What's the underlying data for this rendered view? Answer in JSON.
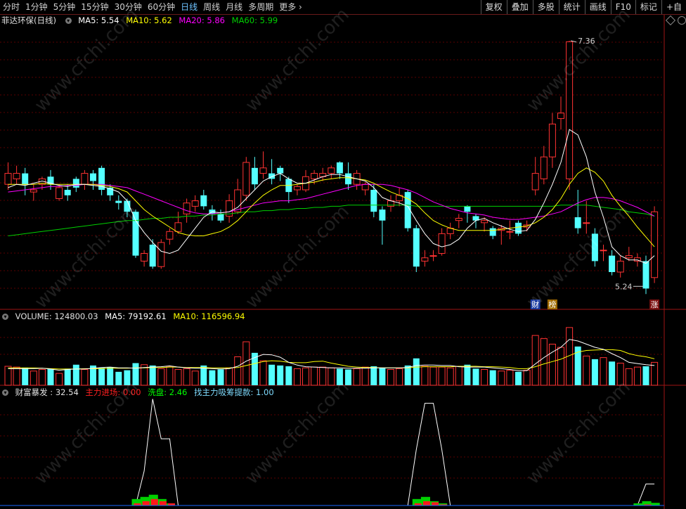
{
  "toolbar": {
    "periods": [
      "分时",
      "1分钟",
      "5分钟",
      "15分钟",
      "30分钟",
      "60分钟",
      "日线",
      "周线",
      "月线",
      "多周期",
      "更多"
    ],
    "active_period": "日线",
    "right_buttons": [
      "复权",
      "叠加",
      "多股",
      "统计",
      "画线",
      "F10",
      "标记",
      "+自"
    ]
  },
  "price_legend": {
    "name": "菲达环保(日线)",
    "ma5": "MA5: 5.54",
    "ma10": "MA10: 5.62",
    "ma20": "MA20: 5.86",
    "ma60": "MA60: 5.99"
  },
  "volume_legend": {
    "volume": "VOLUME: 124800.03",
    "ma5": "MA5: 79192.61",
    "ma10": "MA10: 116596.94"
  },
  "indicator_legend": {
    "name": "财富暴发 : 32.54",
    "main_entry": "主力进场: 0.00",
    "washout": "洗盘: 2.46",
    "accumulation": "找主力吸筹提款: 1.00"
  },
  "colors": {
    "up": "#ff3232",
    "down": "#54ffff",
    "ma5": "#ffffff",
    "ma10": "#ffff00",
    "ma20": "#ff00ff",
    "ma60": "#00d000",
    "grid": "#5a0000",
    "separator": "#a01414"
  },
  "chart_data": [
    {
      "type": "candlestick",
      "series_name": "菲达环保(日线)",
      "ylim": [
        5.0,
        7.5
      ],
      "high_label": "7.36",
      "low_label": "5.24",
      "markers": [
        "财",
        "榜",
        "涨"
      ],
      "candles": [
        [
          6.05,
          6.15,
          6.25,
          6.0
        ],
        [
          6.1,
          6.15,
          6.22,
          6.05
        ],
        [
          6.15,
          6.05,
          6.2,
          5.95
        ],
        [
          5.98,
          6.0,
          6.05,
          5.9
        ],
        [
          6.05,
          6.1,
          6.12,
          6.0
        ],
        [
          6.12,
          6.05,
          6.18,
          6.0
        ],
        [
          5.92,
          6.02,
          6.05,
          5.9
        ],
        [
          6.0,
          5.95,
          6.05,
          5.9
        ],
        [
          6.1,
          6.02,
          6.12,
          5.98
        ],
        [
          6.05,
          6.15,
          6.18,
          6.0
        ],
        [
          6.15,
          6.08,
          6.18,
          6.0
        ],
        [
          6.2,
          6.0,
          6.22,
          5.95
        ],
        [
          6.02,
          5.95,
          6.05,
          5.9
        ],
        [
          5.9,
          5.88,
          5.95,
          5.82
        ],
        [
          5.9,
          5.8,
          5.92,
          5.75
        ],
        [
          5.8,
          5.4,
          5.82,
          5.38
        ],
        [
          5.35,
          5.42,
          5.45,
          5.3
        ],
        [
          5.5,
          5.3,
          5.55,
          5.28
        ],
        [
          5.3,
          5.52,
          5.55,
          5.28
        ],
        [
          5.55,
          5.62,
          5.65,
          5.5
        ],
        [
          5.62,
          5.7,
          5.8,
          5.6
        ],
        [
          5.78,
          5.88,
          5.92,
          5.7
        ],
        [
          5.85,
          5.9,
          5.95,
          5.8
        ],
        [
          5.95,
          5.85,
          6.0,
          5.82
        ],
        [
          5.82,
          5.78,
          5.86,
          5.72
        ],
        [
          5.78,
          5.72,
          5.82,
          5.7
        ],
        [
          5.76,
          5.9,
          5.96,
          5.7
        ],
        [
          5.8,
          6.0,
          6.1,
          5.78
        ],
        [
          5.95,
          6.25,
          6.3,
          5.9
        ],
        [
          6.2,
          6.05,
          6.3,
          6.0
        ],
        [
          6.15,
          6.2,
          6.35,
          6.1
        ],
        [
          6.15,
          6.1,
          6.28,
          6.05
        ],
        [
          6.2,
          6.15,
          6.22,
          6.08
        ],
        [
          6.1,
          5.98,
          6.12,
          5.88
        ],
        [
          6.0,
          6.03,
          6.05,
          5.95
        ],
        [
          6.0,
          6.12,
          6.18,
          5.98
        ],
        [
          6.1,
          6.15,
          6.18,
          6.05
        ],
        [
          6.12,
          6.15,
          6.2,
          6.08
        ],
        [
          6.15,
          6.2,
          6.22,
          6.1
        ],
        [
          6.25,
          6.15,
          6.26,
          6.1
        ],
        [
          6.15,
          6.05,
          6.25,
          6.0
        ],
        [
          6.05,
          6.15,
          6.18,
          6.0
        ],
        [
          6.0,
          6.05,
          6.07,
          5.95
        ],
        [
          6.0,
          5.8,
          6.05,
          5.75
        ],
        [
          5.82,
          5.72,
          5.85,
          5.5
        ],
        [
          5.85,
          5.9,
          5.95,
          5.8
        ],
        [
          5.9,
          5.95,
          6.02,
          5.85
        ],
        [
          5.98,
          5.65,
          6.0,
          5.62
        ],
        [
          5.65,
          5.3,
          5.68,
          5.25
        ],
        [
          5.35,
          5.38,
          5.45,
          5.3
        ],
        [
          5.4,
          5.4,
          5.45,
          5.35
        ],
        [
          5.42,
          5.6,
          5.65,
          5.4
        ],
        [
          5.6,
          5.65,
          5.7,
          5.55
        ],
        [
          5.72,
          5.74,
          5.78,
          5.65
        ],
        [
          5.85,
          5.8,
          5.86,
          5.7
        ],
        [
          5.76,
          5.72,
          5.78,
          5.65
        ],
        [
          5.7,
          5.72,
          5.75,
          5.62
        ],
        [
          5.65,
          5.58,
          5.67,
          5.55
        ],
        [
          5.63,
          5.65,
          5.68,
          5.5
        ],
        [
          5.62,
          5.62,
          5.72,
          5.55
        ],
        [
          5.7,
          5.6,
          5.72,
          5.58
        ],
        [
          5.66,
          5.68,
          5.72,
          5.62
        ],
        [
          6.0,
          6.15,
          6.3,
          5.95
        ],
        [
          6.1,
          6.3,
          6.4,
          6.05
        ],
        [
          6.3,
          6.6,
          6.7,
          6.2
        ],
        [
          6.65,
          6.7,
          6.85,
          6.55
        ],
        [
          6.1,
          7.35,
          7.36,
          6.0
        ],
        [
          5.75,
          5.65,
          6.0,
          5.6
        ],
        [
          5.7,
          5.7,
          5.9,
          5.6
        ],
        [
          5.6,
          5.35,
          5.65,
          5.3
        ],
        [
          5.45,
          5.45,
          5.5,
          5.35
        ],
        [
          5.4,
          5.25,
          5.45,
          5.22
        ],
        [
          5.25,
          5.35,
          5.4,
          5.2
        ],
        [
          5.38,
          5.4,
          5.48,
          5.35
        ],
        [
          5.35,
          5.38,
          5.42,
          5.3
        ],
        [
          5.35,
          5.1,
          5.4,
          5.05
        ],
        [
          5.2,
          5.8,
          5.85,
          5.15
        ]
      ],
      "ma5": [
        6.02,
        6.05,
        6.04,
        6.06,
        6.08,
        6.06,
        6.04,
        6.03,
        6.05,
        6.05,
        6.04,
        6.03,
        6.01,
        5.98,
        5.9,
        5.72,
        5.61,
        5.52,
        5.44,
        5.42,
        5.45,
        5.55,
        5.65,
        5.75,
        5.8,
        5.79,
        5.8,
        5.84,
        5.92,
        6.0,
        6.08,
        6.12,
        6.15,
        6.1,
        6.06,
        6.06,
        6.09,
        6.12,
        6.14,
        6.14,
        6.12,
        6.1,
        6.08,
        6.02,
        5.93,
        5.9,
        5.88,
        5.85,
        5.72,
        5.6,
        5.51,
        5.48,
        5.5,
        5.55,
        5.65,
        5.72,
        5.74,
        5.7,
        5.67,
        5.64,
        5.62,
        5.63,
        5.73,
        5.88,
        6.05,
        6.25,
        6.55,
        6.5,
        6.3,
        5.98,
        5.75,
        5.48,
        5.4,
        5.36,
        5.36,
        5.33,
        5.4
      ],
      "ma10": [
        6.05,
        6.05,
        6.05,
        6.05,
        6.06,
        6.05,
        6.05,
        6.05,
        6.05,
        6.05,
        6.05,
        6.04,
        6.03,
        6.01,
        5.98,
        5.9,
        5.82,
        5.76,
        5.71,
        5.66,
        5.61,
        5.59,
        5.58,
        5.58,
        5.6,
        5.62,
        5.66,
        5.72,
        5.8,
        5.88,
        5.95,
        6.0,
        6.04,
        6.04,
        6.05,
        6.06,
        6.07,
        6.09,
        6.1,
        6.11,
        6.11,
        6.1,
        6.09,
        6.06,
        6.02,
        5.98,
        5.95,
        5.92,
        5.87,
        5.79,
        5.72,
        5.68,
        5.65,
        5.63,
        5.63,
        5.63,
        5.63,
        5.63,
        5.64,
        5.65,
        5.66,
        5.67,
        5.7,
        5.75,
        5.82,
        5.92,
        6.05,
        6.15,
        6.2,
        6.16,
        6.08,
        5.95,
        5.85,
        5.76,
        5.66,
        5.57,
        5.48
      ],
      "ma20": [
        5.98,
        5.99,
        6.0,
        6.01,
        6.02,
        6.03,
        6.03,
        6.04,
        6.04,
        6.05,
        6.05,
        6.05,
        6.04,
        6.03,
        6.02,
        5.99,
        5.96,
        5.93,
        5.9,
        5.87,
        5.84,
        5.81,
        5.79,
        5.78,
        5.78,
        5.79,
        5.8,
        5.82,
        5.84,
        5.86,
        5.88,
        5.89,
        5.9,
        5.9,
        5.91,
        5.92,
        5.94,
        5.96,
        5.98,
        6.0,
        6.02,
        6.04,
        6.05,
        6.05,
        6.05,
        6.04,
        6.02,
        6.0,
        5.97,
        5.93,
        5.89,
        5.86,
        5.83,
        5.81,
        5.79,
        5.78,
        5.77,
        5.75,
        5.74,
        5.73,
        5.73,
        5.74,
        5.75,
        5.76,
        5.78,
        5.8,
        5.84,
        5.88,
        5.91,
        5.93,
        5.93,
        5.92,
        5.9,
        5.87,
        5.84,
        5.8,
        5.76
      ],
      "ma60": [
        5.58,
        5.59,
        5.6,
        5.61,
        5.62,
        5.63,
        5.64,
        5.65,
        5.66,
        5.67,
        5.68,
        5.69,
        5.7,
        5.71,
        5.72,
        5.72,
        5.73,
        5.74,
        5.74,
        5.75,
        5.75,
        5.76,
        5.76,
        5.77,
        5.77,
        5.78,
        5.78,
        5.79,
        5.8,
        5.8,
        5.81,
        5.81,
        5.82,
        5.82,
        5.83,
        5.83,
        5.84,
        5.84,
        5.85,
        5.85,
        5.86,
        5.86,
        5.86,
        5.86,
        5.86,
        5.86,
        5.86,
        5.86,
        5.85,
        5.85,
        5.85,
        5.85,
        5.85,
        5.85,
        5.85,
        5.85,
        5.85,
        5.85,
        5.85,
        5.85,
        5.85,
        5.85,
        5.85,
        5.85,
        5.85,
        5.86,
        5.86,
        5.86,
        5.86,
        5.85,
        5.84,
        5.83,
        5.82,
        5.8,
        5.79,
        5.78,
        5.76
      ]
    },
    {
      "type": "bar",
      "series_name": "VOLUME",
      "ylim": [
        0,
        160000
      ],
      "volume": [
        48000,
        46000,
        44000,
        36000,
        40000,
        42000,
        30000,
        42000,
        52000,
        40000,
        50000,
        44000,
        46000,
        34000,
        38000,
        56000,
        52000,
        50000,
        42000,
        48000,
        40000,
        42000,
        36000,
        50000,
        38000,
        40000,
        44000,
        72000,
        110000,
        82000,
        62000,
        52000,
        50000,
        48000,
        42000,
        44000,
        46000,
        46000,
        44000,
        42000,
        40000,
        42000,
        46000,
        48000,
        44000,
        40000,
        42000,
        50000,
        68000,
        48000,
        46000,
        46000,
        44000,
        48000,
        52000,
        42000,
        40000,
        38000,
        36000,
        38000,
        34000,
        38000,
        126000,
        118000,
        104000,
        96000,
        146000,
        98000,
        74000,
        66000,
        70000,
        60000,
        56000,
        42000,
        46000,
        48000,
        58000
      ],
      "ma5": [
        42000,
        42000,
        42000,
        42000,
        43000,
        41000,
        38000,
        40000,
        41000,
        41000,
        43000,
        45000,
        46000,
        44000,
        44000,
        43000,
        45000,
        46000,
        47000,
        49000,
        46000,
        44000,
        43000,
        43000,
        42000,
        41000,
        42000,
        48000,
        61000,
        70000,
        78000,
        77000,
        71000,
        58000,
        51000,
        47000,
        46000,
        45000,
        44000,
        44000,
        43000,
        43000,
        43000,
        44000,
        44000,
        44000,
        44000,
        45000,
        50000,
        51000,
        51000,
        50000,
        50000,
        47000,
        46000,
        46000,
        46000,
        44000,
        42000,
        40000,
        37000,
        37000,
        54000,
        70000,
        84000,
        96000,
        116000,
        112000,
        104000,
        96000,
        91000,
        80000,
        70000,
        58000,
        55000,
        52000,
        50000
      ],
      "ma10": [
        44000,
        44000,
        44000,
        44000,
        43000,
        42000,
        41000,
        41000,
        41000,
        42000,
        42000,
        42000,
        43000,
        43000,
        43000,
        44000,
        44000,
        45000,
        45000,
        46000,
        46000,
        45000,
        45000,
        45000,
        44000,
        44000,
        44000,
        45000,
        50000,
        55000,
        60000,
        62000,
        61000,
        58000,
        57000,
        57000,
        60000,
        61000,
        56000,
        52000,
        48000,
        46000,
        45000,
        45000,
        44000,
        44000,
        44000,
        44000,
        46000,
        47000,
        47000,
        47000,
        47000,
        48000,
        48000,
        48000,
        47000,
        47000,
        46000,
        45000,
        42000,
        42000,
        47000,
        54000,
        60000,
        66000,
        75000,
        84000,
        88000,
        89000,
        90000,
        90000,
        88000,
        80000,
        75000,
        72000,
        67000
      ],
      "ma_labels": [
        "MA5",
        "MA10"
      ]
    },
    {
      "type": "area",
      "series_name": "财富暴发",
      "ylim": [
        0,
        100
      ],
      "main_curve": [
        0,
        0,
        0,
        0,
        0,
        0,
        0,
        0,
        0,
        0,
        0,
        0,
        0,
        0,
        0,
        0,
        0,
        0,
        0,
        0,
        0,
        0,
        0,
        0,
        0,
        0,
        0,
        0,
        0,
        0,
        0,
        0,
        0,
        0,
        0,
        0,
        0,
        0,
        0,
        0,
        0,
        0,
        0,
        0,
        0,
        0,
        0,
        0,
        0,
        0,
        0,
        0,
        0,
        0,
        0,
        0,
        0,
        0,
        0,
        0,
        0,
        0,
        0,
        0,
        0,
        0,
        0,
        0,
        0,
        0,
        0,
        0,
        0,
        0,
        0,
        20,
        20
      ],
      "peaks": [
        {
          "points": [
            [
              15,
              0
            ],
            [
              16,
              32
            ],
            [
              17,
              99
            ],
            [
              18,
              62
            ],
            [
              19,
              62
            ],
            [
              20,
              0
            ]
          ]
        },
        {
          "points": [
            [
              47,
              0
            ],
            [
              48,
              52
            ],
            [
              49,
              95
            ],
            [
              50,
              95
            ],
            [
              51,
              52
            ],
            [
              52,
              0
            ]
          ]
        },
        {
          "points": [
            [
              74,
              0
            ],
            [
              75,
              20
            ],
            [
              76,
              20
            ]
          ]
        }
      ],
      "washout": [
        0,
        0,
        0,
        0,
        0,
        0,
        0,
        0,
        0,
        0,
        0,
        0,
        0,
        0,
        0,
        6,
        8,
        10,
        6,
        2,
        0,
        0,
        0,
        0,
        0,
        0,
        0,
        0,
        0,
        0,
        0,
        0,
        0,
        0,
        0,
        0,
        0,
        0,
        0,
        0,
        0,
        0,
        0,
        0,
        0,
        0,
        0,
        0,
        6,
        8,
        4,
        2,
        0,
        0,
        0,
        0,
        0,
        0,
        0,
        0,
        0,
        0,
        0,
        0,
        0,
        0,
        0,
        0,
        0,
        0,
        0,
        0,
        0,
        0,
        2,
        4,
        2.46
      ],
      "main_entry": [
        0,
        0,
        0,
        0,
        0,
        0,
        0,
        0,
        0,
        0,
        0,
        0,
        0,
        0,
        0,
        2,
        4,
        6,
        4,
        2,
        0,
        0,
        0,
        0,
        0,
        0,
        0,
        0,
        0,
        0,
        0,
        0,
        0,
        0,
        0,
        0,
        0,
        0,
        0,
        0,
        0,
        0,
        0,
        0,
        0,
        0,
        0,
        0,
        2,
        4,
        3,
        1,
        0,
        0,
        0,
        0,
        0,
        0,
        0,
        0,
        0,
        0,
        0,
        0,
        0,
        0,
        0,
        0,
        0,
        0,
        0,
        0,
        0,
        0,
        0,
        1,
        0
      ]
    }
  ]
}
